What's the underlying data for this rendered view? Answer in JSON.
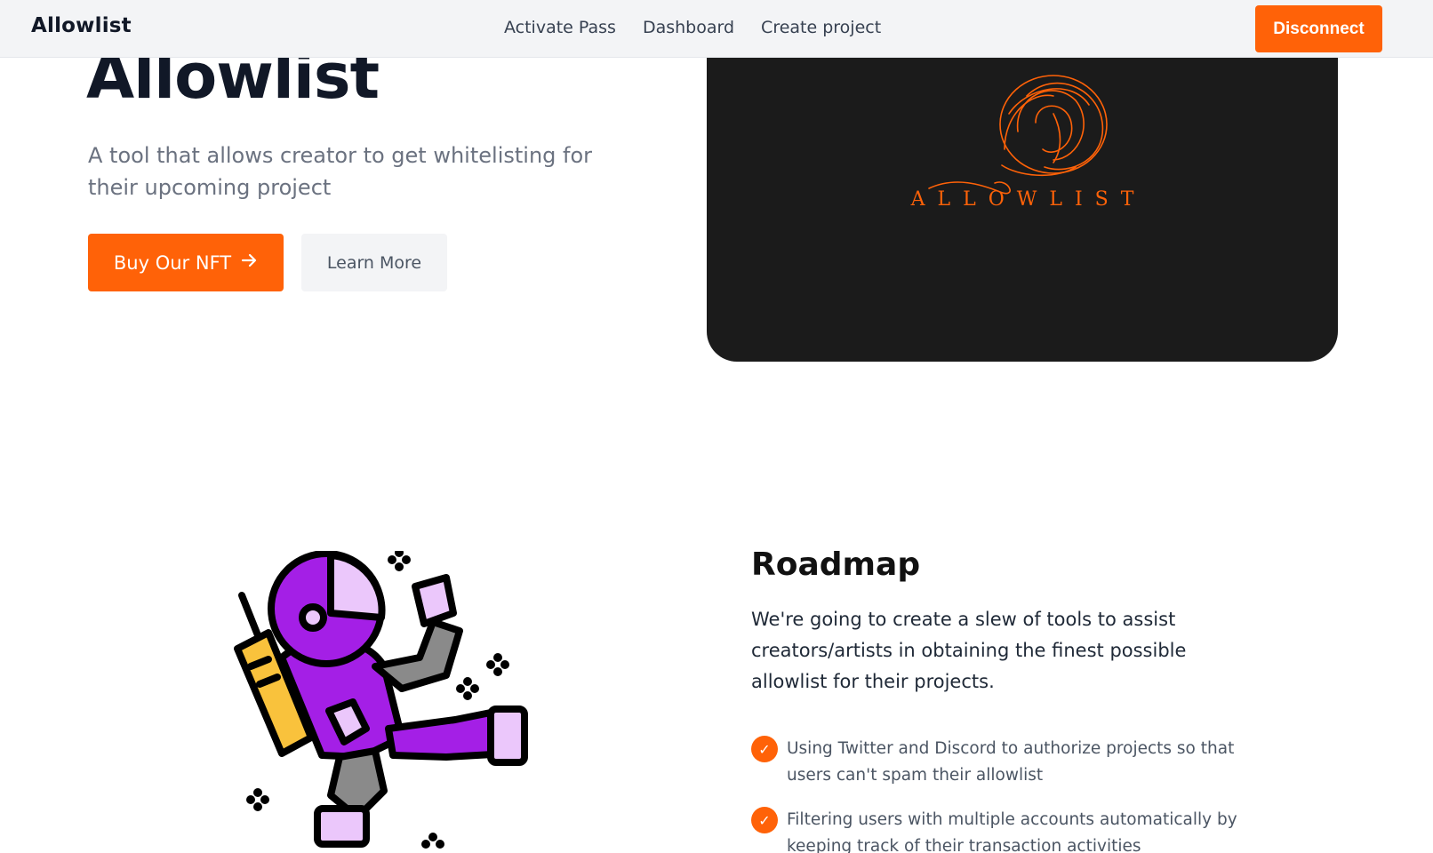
{
  "navbar": {
    "brand": "Allowlist",
    "links": [
      "Activate Pass",
      "Dashboard",
      "Create project"
    ],
    "disconnect_label": "Disconnect"
  },
  "hero": {
    "title": "Allowlist",
    "description": "A tool that allows creator to get whitelisting for their upcoming project",
    "primary_button": "Buy Our NFT",
    "secondary_button": "Learn More",
    "logo_wordmark": "ALLOWLIST",
    "card_color": "#1b1b1b"
  },
  "roadmap": {
    "title": "Roadmap",
    "description": "We're going to create a slew of tools to assist creators/artists in obtaining the finest possible allowlist for their projects.",
    "items": [
      "Using Twitter and Discord to authorize projects so that users can't spam their allowlist",
      "Filtering users with multiple accounts automatically by keeping track of their transaction activities"
    ]
  },
  "colors": {
    "accent": "#ff6208",
    "astronaut_suit": "#a41fe6",
    "astronaut_visor": "#ebc7fb",
    "backpack": "#f9c23c"
  },
  "icons": {
    "arrow": "arrow-right-icon",
    "check": "check-circle-icon"
  }
}
